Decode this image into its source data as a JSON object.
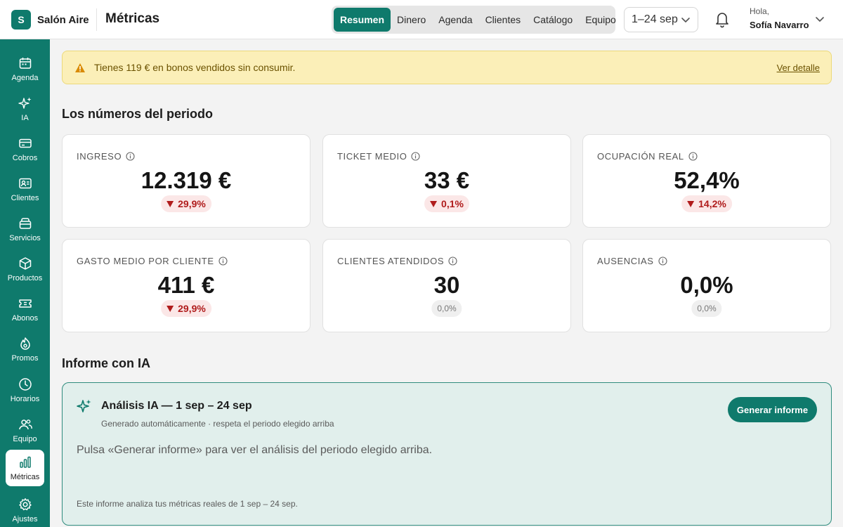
{
  "brand": {
    "logo_letter": "S",
    "name": "Salón Aire"
  },
  "header": {
    "title": "Métricas",
    "tabs": [
      "Resumen",
      "Dinero",
      "Agenda",
      "Clientes",
      "Catálogo",
      "Equipo"
    ],
    "active_tab": "Resumen",
    "period": "1–24 sep",
    "greeting": "Hola,",
    "user_name": "Sofía Navarro"
  },
  "sidebar": {
    "items": [
      {
        "label": "Agenda",
        "icon": "calendar-icon"
      },
      {
        "label": "IA",
        "icon": "sparkles-icon"
      },
      {
        "label": "Cobros",
        "icon": "credit-card-icon"
      },
      {
        "label": "Clientes",
        "icon": "contact-card-icon"
      },
      {
        "label": "Servicios",
        "icon": "tray-icon"
      },
      {
        "label": "Productos",
        "icon": "box-icon"
      },
      {
        "label": "Abonos",
        "icon": "ticket-icon"
      },
      {
        "label": "Promos",
        "icon": "flame-icon"
      },
      {
        "label": "Horarios",
        "icon": "clock-icon"
      },
      {
        "label": "Equipo",
        "icon": "users-icon"
      },
      {
        "label": "Métricas",
        "icon": "bar-chart-icon",
        "active": true
      },
      {
        "label": "Ajustes",
        "icon": "gear-icon"
      }
    ]
  },
  "alert": {
    "text": "Tienes 119 € en bonos vendidos sin consumir.",
    "link": "Ver detalle"
  },
  "metrics": {
    "section_title": "Los números del periodo",
    "cards": [
      {
        "label": "INGRESO",
        "value": "12.319 €",
        "delta": "29,9%",
        "trend": "down"
      },
      {
        "label": "TICKET MEDIO",
        "value": "33 €",
        "delta": "0,1%",
        "trend": "down"
      },
      {
        "label": "OCUPACIÓN REAL",
        "value": "52,4%",
        "delta": "14,2%",
        "trend": "down"
      },
      {
        "label": "GASTO MEDIO POR CLIENTE",
        "value": "411 €",
        "delta": "29,9%",
        "trend": "down"
      },
      {
        "label": "CLIENTES ATENDIDOS",
        "value": "30",
        "delta": "0,0%",
        "trend": "neutral"
      },
      {
        "label": "AUSENCIAS",
        "value": "0,0%",
        "delta": "0,0%",
        "trend": "neutral"
      }
    ]
  },
  "ai_report": {
    "section_title": "Informe con IA",
    "title": "Análisis IA — 1 sep – 24 sep",
    "subtitle": "Generado automáticamente · respeta el periodo elegido arriba",
    "body": "Pulsa «Generar informe» para ver el análisis del periodo elegido arriba.",
    "footer": "Este informe analiza tus métricas reales de 1 sep – 24 sep.",
    "button": "Generar informe"
  },
  "colors": {
    "accent": "#0f7a6c",
    "alert_bg": "#fbefb8",
    "negative": "#b01c1c",
    "ai_bg": "#e1efec"
  }
}
